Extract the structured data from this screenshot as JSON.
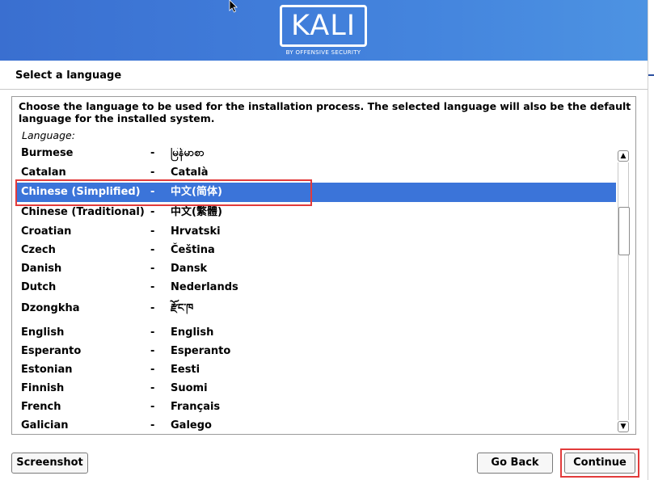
{
  "brand": {
    "logo_text": "KALI",
    "logo_subtitle": "BY OFFENSIVE SECURITY",
    "accent_color": "#3b74d9",
    "highlight_color": "#e23b3b"
  },
  "page": {
    "title": "Select a language",
    "instructions": "Choose the language to be used for the installation process. The selected language will also be the default language for the installed system.",
    "list_label": "Language:"
  },
  "languages": [
    {
      "name": "Burmese",
      "dash": "-",
      "native": "မြန်မာစာ"
    },
    {
      "name": "Catalan",
      "dash": "-",
      "native": "Català"
    },
    {
      "name": "Chinese (Simplified)",
      "dash": "-",
      "native": "中文(简体)",
      "selected": true
    },
    {
      "name": "Chinese (Traditional)",
      "dash": "-",
      "native": "中文(繁體)"
    },
    {
      "name": "Croatian",
      "dash": "-",
      "native": "Hrvatski"
    },
    {
      "name": "Czech",
      "dash": "-",
      "native": "Čeština"
    },
    {
      "name": "Danish",
      "dash": "-",
      "native": "Dansk"
    },
    {
      "name": "Dutch",
      "dash": "-",
      "native": "Nederlands"
    },
    {
      "name": "Dzongkha",
      "dash": "-",
      "native": "རྫོང་ཁ"
    },
    {
      "name": "English",
      "dash": "-",
      "native": "English"
    },
    {
      "name": "Esperanto",
      "dash": "-",
      "native": "Esperanto"
    },
    {
      "name": "Estonian",
      "dash": "-",
      "native": "Eesti"
    },
    {
      "name": "Finnish",
      "dash": "-",
      "native": "Suomi"
    },
    {
      "name": "French",
      "dash": "-",
      "native": "Français"
    },
    {
      "name": "Galician",
      "dash": "-",
      "native": "Galego"
    }
  ],
  "scrollbar": {
    "up_icon": "chevron-up-icon",
    "down_icon": "chevron-down-icon"
  },
  "buttons": {
    "screenshot": "Screenshot",
    "go_back": "Go Back",
    "continue": "Continue"
  }
}
